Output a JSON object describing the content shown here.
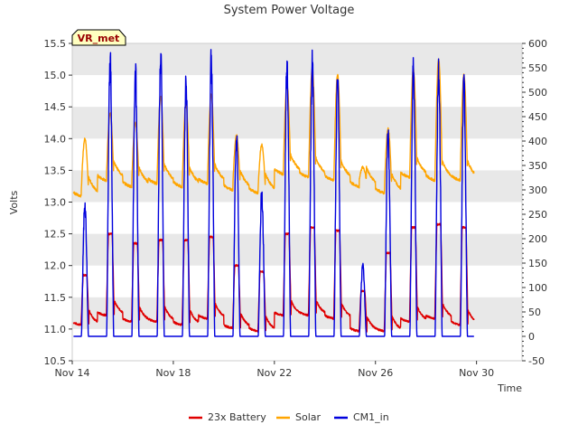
{
  "chart_data": {
    "type": "line",
    "title": "System Power Voltage",
    "badge": "VR_met",
    "xlabel": "Time",
    "ylabel": "Volts",
    "ylim": [
      10.5,
      15.5
    ],
    "y2lim": [
      -50,
      600
    ],
    "xlim": [
      0,
      17.8
    ],
    "yticks": [
      10.5,
      11.0,
      11.5,
      12.0,
      12.5,
      13.0,
      13.5,
      14.0,
      14.5,
      15.0,
      15.5
    ],
    "y2ticks": [
      -50,
      0,
      50,
      100,
      150,
      200,
      250,
      300,
      350,
      400,
      450,
      500,
      550,
      600
    ],
    "xtick_days": [
      0,
      4,
      8,
      12,
      16
    ],
    "xtick_labels": [
      "Nov 14",
      "Nov 18",
      "Nov 22",
      "Nov 26",
      "Nov 30"
    ],
    "grid": true,
    "legend_position": "bottom-center",
    "colors": {
      "battery": "#e00000",
      "solar": "#ffa500",
      "cm1": "#0000dd",
      "band": "#e8e8e8"
    },
    "series": [
      {
        "name": "23x Battery",
        "axis": "left",
        "color": "#e00000"
      },
      {
        "name": "Solar",
        "axis": "left",
        "color": "#ffa500"
      },
      {
        "name": "CM1_in",
        "axis": "right",
        "color": "#0000dd"
      }
    ],
    "days": [
      {
        "day": 0,
        "cm1_peak": 270,
        "bat_peak": 11.85,
        "sol_peak": 13.85,
        "night_bat": 11.05,
        "night_sol": 13.05
      },
      {
        "day": 1,
        "cm1_peak": 560,
        "bat_peak": 12.5,
        "sol_peak": 14.25,
        "night_bat": 11.2,
        "night_sol": 13.3
      },
      {
        "day": 2,
        "cm1_peak": 540,
        "bat_peak": 12.35,
        "sol_peak": 14.1,
        "night_bat": 11.1,
        "night_sol": 13.2
      },
      {
        "day": 3,
        "cm1_peak": 580,
        "bat_peak": 12.4,
        "sol_peak": 14.5,
        "night_bat": 11.1,
        "night_sol": 13.25
      },
      {
        "day": 4,
        "cm1_peak": 520,
        "bat_peak": 12.4,
        "sol_peak": 14.4,
        "night_bat": 11.05,
        "night_sol": 13.2
      },
      {
        "day": 5,
        "cm1_peak": 560,
        "bat_peak": 12.45,
        "sol_peak": 14.55,
        "night_bat": 11.15,
        "night_sol": 13.25
      },
      {
        "day": 6,
        "cm1_peak": 410,
        "bat_peak": 12.0,
        "sol_peak": 13.9,
        "night_bat": 11.0,
        "night_sol": 13.15
      },
      {
        "day": 7,
        "cm1_peak": 290,
        "bat_peak": 11.9,
        "sol_peak": 13.75,
        "night_bat": 10.95,
        "night_sol": 13.1
      },
      {
        "day": 8,
        "cm1_peak": 560,
        "bat_peak": 12.5,
        "sol_peak": 14.7,
        "night_bat": 11.2,
        "night_sol": 13.4
      },
      {
        "day": 9,
        "cm1_peak": 555,
        "bat_peak": 12.6,
        "sol_peak": 14.95,
        "night_bat": 11.2,
        "night_sol": 13.35
      },
      {
        "day": 10,
        "cm1_peak": 525,
        "bat_peak": 12.55,
        "sol_peak": 14.85,
        "night_bat": 11.15,
        "night_sol": 13.3
      },
      {
        "day": 11,
        "cm1_peak": 145,
        "bat_peak": 11.6,
        "sol_peak": 13.4,
        "night_bat": 10.95,
        "night_sol": 13.2
      },
      {
        "day": 12,
        "cm1_peak": 410,
        "bat_peak": 12.2,
        "sol_peak": 14.0,
        "night_bat": 10.95,
        "night_sol": 13.1
      },
      {
        "day": 13,
        "cm1_peak": 545,
        "bat_peak": 12.6,
        "sol_peak": 14.95,
        "night_bat": 11.1,
        "night_sol": 13.35
      },
      {
        "day": 14,
        "cm1_peak": 545,
        "bat_peak": 12.65,
        "sol_peak": 15.1,
        "night_bat": 11.15,
        "night_sol": 13.3
      },
      {
        "day": 15,
        "cm1_peak": 515,
        "bat_peak": 12.6,
        "sol_peak": 14.85,
        "night_bat": 11.05,
        "night_sol": 13.3
      }
    ]
  },
  "legend": {
    "battery_label": "23x Battery",
    "solar_label": "Solar",
    "cm1_label": "CM1_in"
  }
}
